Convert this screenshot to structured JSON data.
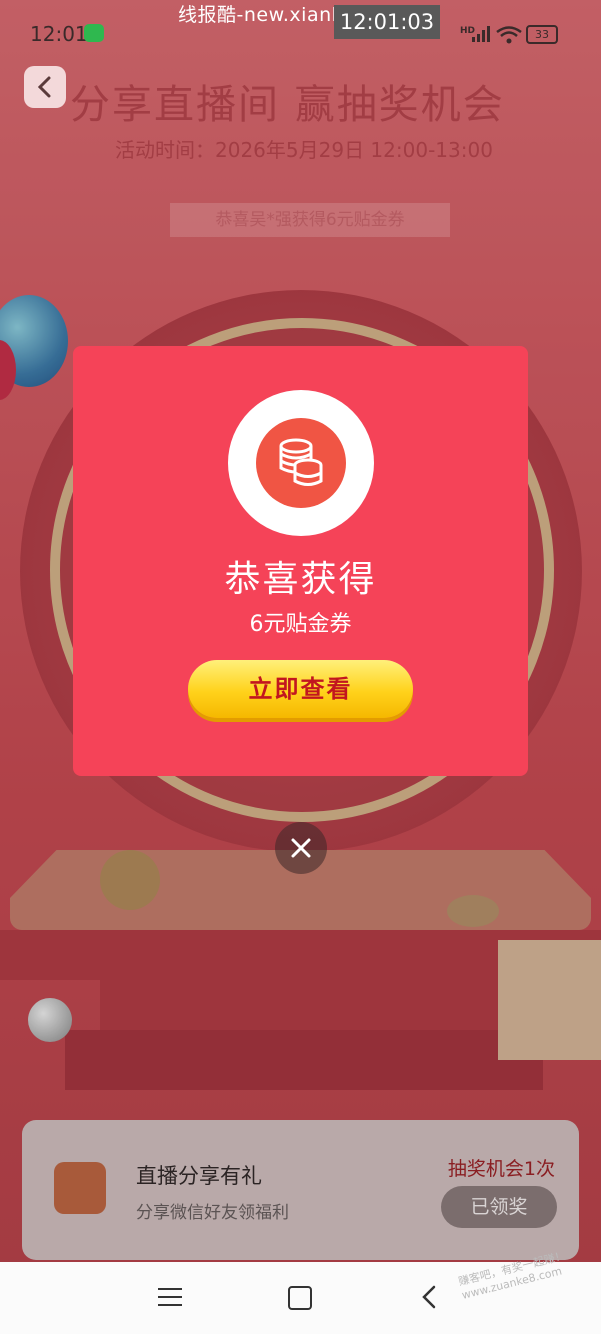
{
  "status_bar": {
    "time": "12:01",
    "overlay_time": "12:01:03",
    "watermark": "线报酷-new.xianbao.fun",
    "network_label": "HD",
    "battery": "33"
  },
  "header": {
    "title": "分享直播间 赢抽奖机会",
    "activity_time": "活动时间：2026年5月29日 12:00-13:00",
    "ticker": "恭喜吴*强获得6元贴金券"
  },
  "modal": {
    "title": "恭喜获得",
    "prize": "6元贴金券",
    "button": "立即查看"
  },
  "task": {
    "title": "直播分享有礼",
    "description": "分享微信好友领福利",
    "chances": "抽奖机会1次",
    "button": "已领奖"
  },
  "footer": {
    "watermark": "赚客吧，有奖一起赚！www.zuanke8.com"
  },
  "colors": {
    "modal_bg": "#f54358",
    "button_yellow": "#ffd21b",
    "button_text": "#c2161f"
  }
}
